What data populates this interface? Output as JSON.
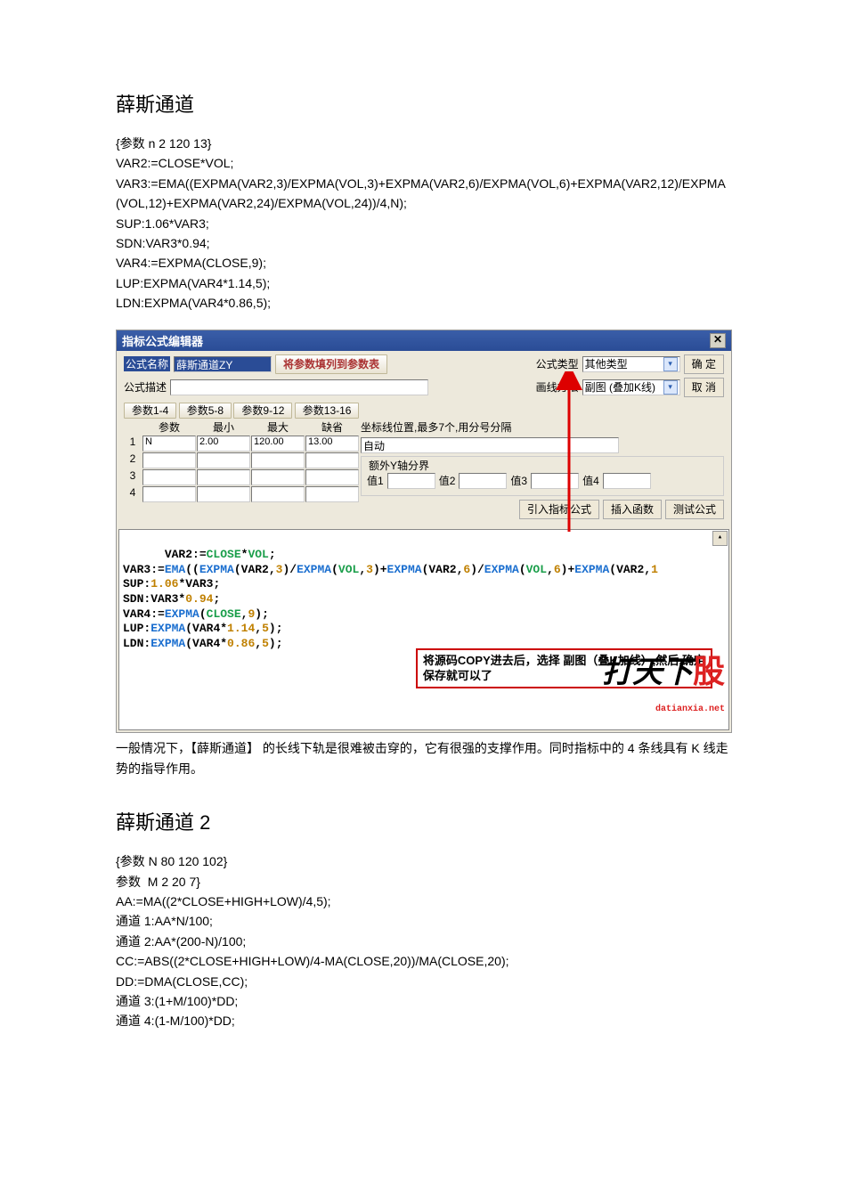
{
  "heading1": "薛斯通道",
  "code1": "{参数 n 2 120 13}\nVAR2:=CLOSE*VOL;\nVAR3:=EMA((EXPMA(VAR2,3)/EXPMA(VOL,3)+EXPMA(VAR2,6)/EXPMA(VOL,6)+EXPMA(VAR2,12)/EXPMA(VOL,12)+EXPMA(VAR2,24)/EXPMA(VOL,24))/4,N);\nSUP:1.06*VAR3;\nSDN:VAR3*0.94;\nVAR4:=EXPMA(CLOSE,9);\nLUP:EXPMA(VAR4*1.14,5);\nLDN:EXPMA(VAR4*0.86,5);",
  "editor": {
    "title": "指标公式编辑器",
    "name_label": "公式名称",
    "name_value": "薛斯通道ZY",
    "param_button": "将参数填列到参数表",
    "desc_label": "公式描述",
    "type_label": "公式类型",
    "type_value": "其他类型",
    "ok_label": "确  定",
    "method_label": "画线方法",
    "method_value": "副图 (叠加K线)",
    "cancel_label": "取  消",
    "tabs": [
      "参数1-4",
      "参数5-8",
      "参数9-12",
      "参数13-16"
    ],
    "col_headers": [
      "参数",
      "最小",
      "最大",
      "缺省"
    ],
    "rows": [
      {
        "n": "1",
        "p": "N",
        "min": "2.00",
        "max": "120.00",
        "def": "13.00"
      },
      {
        "n": "2",
        "p": "",
        "min": "",
        "max": "",
        "def": ""
      },
      {
        "n": "3",
        "p": "",
        "min": "",
        "max": "",
        "def": ""
      },
      {
        "n": "4",
        "p": "",
        "min": "",
        "max": "",
        "def": ""
      }
    ],
    "axis_label": "坐标线位置,最多7个,用分号分隔",
    "axis_value": "自动",
    "extra_group": "额外Y轴分界",
    "vals": [
      "值1",
      "值2",
      "值3",
      "值4"
    ],
    "insert_ind": "引入指标公式",
    "insert_fn": "插入函数",
    "test": "测试公式",
    "note": "将源码COPY进去后，选择 副图（叠K加线）,然后,确定\n保存就可以了",
    "watermark_big": "打天下",
    "watermark_gu": "股",
    "watermark_small": "datianxia.net"
  },
  "after1": "一般情况下，【薛斯通道】 的长线下轨是很难被击穿的，它有很强的支撑作用。同时指标中的 4 条线具有 K 线走势的指导作用。",
  "heading2": "薛斯通道 2",
  "code2": "{参数 N 80 120 102}\n参数  M 2 20 7}\nAA:=MA((2*CLOSE+HIGH+LOW)/4,5);\n通道 1:AA*N/100;\n通道 2:AA*(200-N)/100;\nCC:=ABS((2*CLOSE+HIGH+LOW)/4-MA(CLOSE,20))/MA(CLOSE,20);\nDD:=DMA(CLOSE,CC);\n通道 3:(1+M/100)*DD;\n通道 4:(1-M/100)*DD;"
}
